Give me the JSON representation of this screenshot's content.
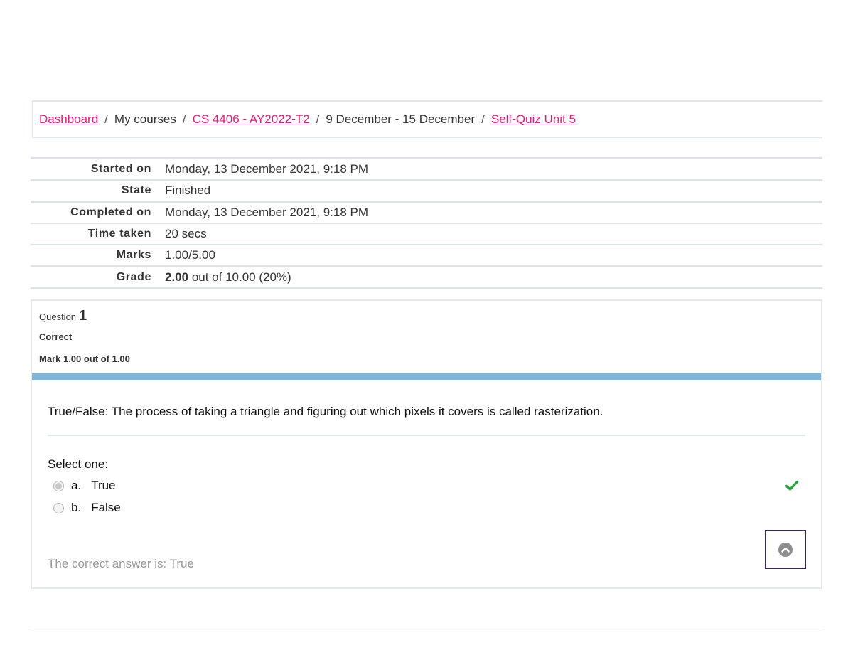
{
  "breadcrumb": {
    "items": [
      {
        "label": "Dashboard",
        "link": true
      },
      {
        "label": "My courses",
        "link": false
      },
      {
        "label": "CS 4406 - AY2022-T2",
        "link": true
      },
      {
        "label": "9 December - 15 December",
        "link": false
      },
      {
        "label": "Self-Quiz Unit 5",
        "link": true
      }
    ],
    "separator": "/"
  },
  "summary": {
    "rows": [
      {
        "label": "Started on",
        "value": "Monday, 13 December 2021, 9:18 PM"
      },
      {
        "label": "State",
        "value": "Finished"
      },
      {
        "label": "Completed on",
        "value": "Monday, 13 December 2021, 9:18 PM"
      },
      {
        "label": "Time taken",
        "value": "20 secs"
      },
      {
        "label": "Marks",
        "value": "1.00/5.00"
      }
    ],
    "grade": {
      "label": "Grade",
      "score": "2.00",
      "rest": " out of 10.00 (20%)"
    }
  },
  "question": {
    "label": "Question",
    "number": "1",
    "state": "Correct",
    "mark": "Mark 1.00 out of 1.00",
    "text": "True/False: The process of taking a triangle and figuring out which pixels it covers is called rasterization.",
    "prompt": "Select one:",
    "answers": [
      {
        "letter": "a.",
        "label": "True",
        "selected": true
      },
      {
        "letter": "b.",
        "label": "False",
        "selected": false
      }
    ],
    "feedback": "The correct answer is: True"
  },
  "colors": {
    "link": "#e8177b",
    "accent_bar": "#7eb5d9",
    "correct_icon": "#1fa83a"
  },
  "icons": {
    "correct": "check-icon",
    "scroll_top": "chevron-up-circle-icon"
  }
}
